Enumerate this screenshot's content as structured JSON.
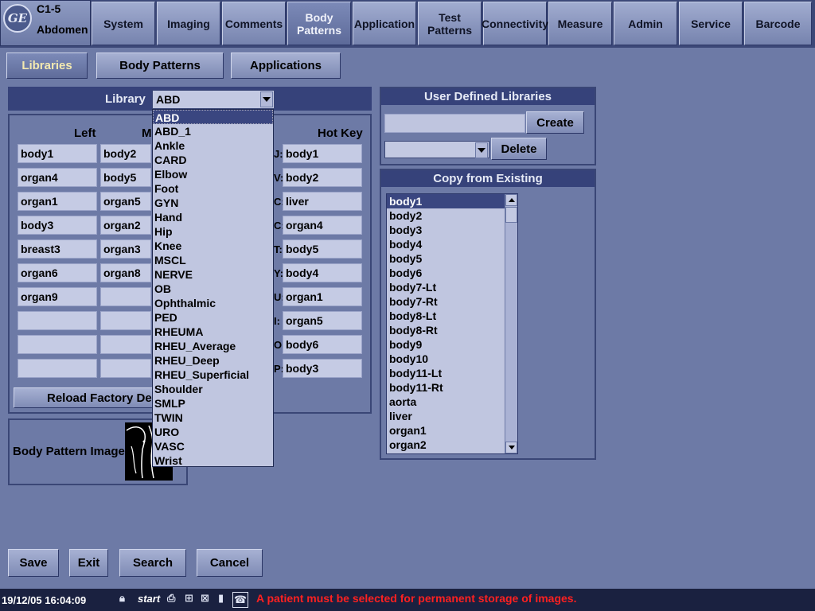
{
  "header": {
    "logo": "GE",
    "probe": "C1-5",
    "preset": "Abdomen",
    "tabs": [
      "System",
      "Imaging",
      "Comments",
      "Body\nPatterns",
      "Application",
      "Test\nPatterns",
      "Connectivity",
      "Measure",
      "Admin",
      "Service",
      "Barcode"
    ],
    "active_tab": "Body Patterns"
  },
  "subtabs": {
    "libraries": "Libraries",
    "body_patterns": "Body Patterns",
    "applications": "Applications",
    "active": "Libraries"
  },
  "library": {
    "label": "Library",
    "selected": "ABD",
    "options": [
      "ABD",
      "ABD_1",
      "Ankle",
      "CARD",
      "Elbow",
      "Foot",
      "GYN",
      "Hand",
      "Hip",
      "Knee",
      "MSCL",
      "NERVE",
      "OB",
      "Ophthalmic",
      "PED",
      "RHEUMA",
      "RHEU_Average",
      "RHEU_Deep",
      "RHEU_Superficial",
      "Shoulder",
      "SMLP",
      "TWIN",
      "URO",
      "VASC",
      "Wrist"
    ]
  },
  "grid": {
    "col_left": "Left",
    "col_middle": "M",
    "col_hotkey": "Hot Key",
    "left": [
      "body1",
      "organ4",
      "organ1",
      "body3",
      "breast3",
      "organ6",
      "organ9",
      "",
      "",
      ""
    ],
    "middle": [
      "body2",
      "body5",
      "organ5",
      "organ2",
      "organ3",
      "organ8",
      "",
      "",
      "",
      ""
    ],
    "hotkey_labels": [
      "J:",
      "V:",
      "C:",
      "C:",
      "T:",
      "Y:",
      "U:",
      "I:",
      "O:",
      "P:"
    ],
    "hotkey": [
      "body1",
      "body2",
      "liver",
      "organ4",
      "body5",
      "body4",
      "organ1",
      "organ5",
      "body6",
      "body3"
    ],
    "reload_label": "Reload Factory De"
  },
  "body_pattern_image_label": "Body Pattern Image",
  "user_defined": {
    "title": "User Defined Libraries",
    "create_label": "Create",
    "delete_label": "Delete",
    "name_value": "",
    "select_value": ""
  },
  "copy_existing": {
    "title": "Copy from Existing",
    "items": [
      "body1",
      "body2",
      "body3",
      "body4",
      "body5",
      "body6",
      "body7-Lt",
      "body7-Rt",
      "body8-Lt",
      "body8-Rt",
      "body9",
      "body10",
      "body11-Lt",
      "body11-Rt",
      "aorta",
      "liver",
      "organ1",
      "organ2"
    ],
    "selected": "body1"
  },
  "bottom_buttons": {
    "save": "Save",
    "exit": "Exit",
    "search": "Search",
    "cancel": "Cancel"
  },
  "statusbar": {
    "datetime": "19/12/05 16:04:09",
    "start": "start",
    "message": "A patient must be selected for permanent storage of images.",
    "icons": [
      "lock-icon",
      "printer-icon",
      "network-icon",
      "network-disconnected-icon",
      "battery-icon",
      "phone-icon"
    ]
  },
  "colors": {
    "background": "#6d7aa6",
    "panel_title": "#36427a",
    "selection": "#3a4680",
    "status_message": "#ff2020",
    "active_subtab_text": "#f3e9b0"
  }
}
